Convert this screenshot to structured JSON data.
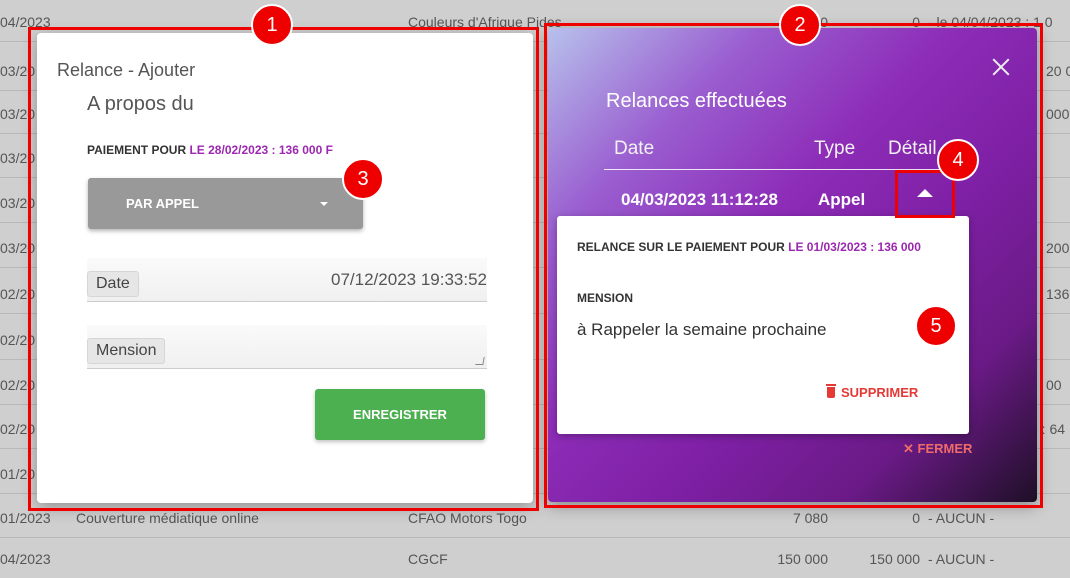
{
  "background_table": {
    "rows": [
      {
        "c1": "04/2023",
        "c2": "",
        "c3": "Couleurs d'Afrique Pides",
        "c4": "1 0",
        "c5": "0",
        "c6": "- le 04/04/2023 : 1 0"
      },
      {
        "c1": "03/20",
        "c2": "",
        "c3": "",
        "c4": "",
        "c5": "",
        "c6": "20 0"
      },
      {
        "c1": "03/20",
        "c2": "",
        "c3": "",
        "c4": "",
        "c5": "",
        "c6": "000"
      },
      {
        "c1": "03/20",
        "c2": "",
        "c3": "",
        "c4": "",
        "c5": "",
        "c6": ""
      },
      {
        "c1": "03/20",
        "c2": "",
        "c3": "",
        "c4": "",
        "c5": "",
        "c6": ""
      },
      {
        "c1": "03/20",
        "c2": "",
        "c3": "",
        "c4": "",
        "c5": "",
        "c6": "200"
      },
      {
        "c1": "02/20",
        "c2": "",
        "c3": "",
        "c4": "",
        "c5": "",
        "c6": "136"
      },
      {
        "c1": "02/20",
        "c2": "",
        "c3": "",
        "c4": "",
        "c5": "",
        "c6": ""
      },
      {
        "c1": "02/20",
        "c2": "",
        "c3": "",
        "c4": "",
        "c5": "",
        "c6": "00"
      },
      {
        "c1": "02/20",
        "c2": "",
        "c3": "",
        "c4": "",
        "c5": "",
        "c6": "e : 64"
      },
      {
        "c1": "01/20",
        "c2": "",
        "c3": "",
        "c4": "",
        "c5": "",
        "c6": ""
      },
      {
        "c1": "01/2023",
        "c2": "Couverture médiatique online",
        "c3": "CFAO Motors Togo",
        "c4": "7 080",
        "c5": "0",
        "c6": "- AUCUN -"
      },
      {
        "c1": "04/2023",
        "c2": "",
        "c3": "CGCF",
        "c4": "150 000",
        "c5": "150 000",
        "c6": "- AUCUN -"
      }
    ]
  },
  "left_modal": {
    "title": "Relance - Ajouter",
    "subtitle": "A propos du",
    "payment_prefix": "PAIEMENT POUR",
    "payment_value": "LE 28/02/2023 : 136 000 F",
    "dropdown_value": "PAR APPEL",
    "date_label": "Date",
    "date_value": "07/12/2023 19:33:52",
    "mension_label": "Mension",
    "save_label": "ENREGISTRER"
  },
  "right_modal": {
    "title": "Relances effectuées",
    "columns": [
      "Date",
      "Type",
      "Détail"
    ],
    "row": {
      "date": "04/03/2023 11:12:28",
      "type": "Appel"
    },
    "detail": {
      "prefix": "RELANCE SUR LE PAIEMENT POUR",
      "value": "LE 01/03/2023 : 136 000",
      "mension_label": "MENSION",
      "mension_text": "à Rappeler la semaine prochaine",
      "delete_label": "SUPPRIMER"
    },
    "close_label": "✕ FERMER"
  },
  "annotations": {
    "badges": [
      "1",
      "2",
      "3",
      "4",
      "5"
    ],
    "color": "#ee0000"
  },
  "colors": {
    "accent": "#9c27b0",
    "save": "#4caf50",
    "delete": "#e53935",
    "close": "#ef6b6b"
  }
}
